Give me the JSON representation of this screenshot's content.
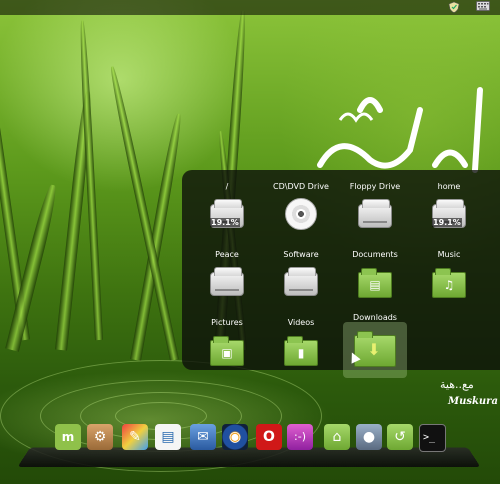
{
  "colors": {
    "panel_bg": "#0c0e0a",
    "folder_green": "#8cc450",
    "label_text": "#ffffff"
  },
  "tray": {
    "icons": [
      "shield-icon",
      "keyboard-icon"
    ]
  },
  "wallpaper": {
    "arabic_tagline": "مع..هية",
    "signature": "Muskura"
  },
  "places": [
    {
      "label": "/",
      "icon": "hard-drive-icon",
      "usage": "19.1%"
    },
    {
      "label": "CD\\DVD Drive",
      "icon": "cd-drive-icon"
    },
    {
      "label": "Floppy Drive",
      "icon": "floppy-drive-icon"
    },
    {
      "label": "home",
      "icon": "hard-drive-icon",
      "usage": "19.1%"
    },
    {
      "label": "Peace",
      "icon": "hard-drive-icon"
    },
    {
      "label": "Software",
      "icon": "hard-drive-icon"
    },
    {
      "label": "Documents",
      "icon": "documents-folder-icon"
    },
    {
      "label": "Music",
      "icon": "music-folder-icon"
    },
    {
      "label": "Pictures",
      "icon": "pictures-folder-icon"
    },
    {
      "label": "Videos",
      "icon": "videos-folder-icon"
    },
    {
      "label": "Downloads",
      "icon": "downloads-folder-icon"
    }
  ],
  "dock": {
    "items": [
      "mint-menu-icon",
      "software-manager-icon",
      "paint-icon",
      "document-viewer-icon",
      "mail-icon",
      "eye-icon",
      "opera-icon",
      "chat-icon",
      "home-folder-icon",
      "drive-icon",
      "time-machine-icon",
      "terminal-icon"
    ]
  }
}
